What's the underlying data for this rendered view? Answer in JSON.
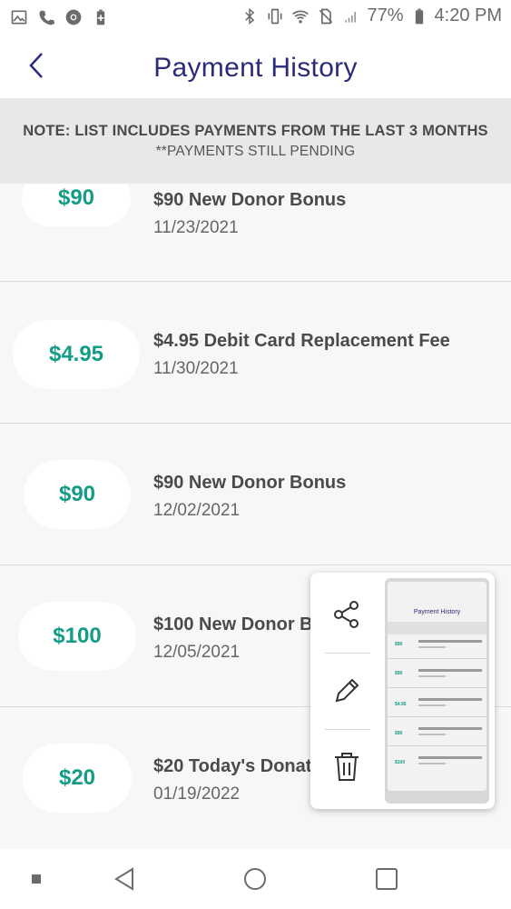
{
  "status_bar": {
    "battery_percent": "77%",
    "time": "4:20 PM",
    "left_icons": [
      "image-icon",
      "phone-icon",
      "chrome-icon",
      "battery-saver-icon"
    ],
    "right_icons": [
      "bluetooth-icon",
      "vibrate-icon",
      "wifi-icon",
      "no-sim-icon",
      "signal-icon",
      "battery-icon"
    ]
  },
  "header": {
    "title": "Payment History",
    "back_icon": "chevron-left-icon"
  },
  "note": {
    "line1": "NOTE: LIST INCLUDES PAYMENTS FROM THE LAST 3 MONTHS",
    "line2": "**PAYMENTS STILL PENDING"
  },
  "payments": [
    {
      "amount": "$90",
      "title": "$90 New Donor Bonus",
      "date": "11/23/2021"
    },
    {
      "amount": "$4.95",
      "title": "$4.95 Debit Card Replacement Fee",
      "date": "11/30/2021"
    },
    {
      "amount": "$90",
      "title": "$90 New Donor Bonus",
      "date": "12/02/2021"
    },
    {
      "amount": "$100",
      "title": "$100 New Donor B",
      "date": "12/05/2021"
    },
    {
      "amount": "$20",
      "title": "$20 Today's Donat",
      "date": "01/19/2022"
    }
  ],
  "screenshot_popup": {
    "actions": [
      "share-icon",
      "edit-icon",
      "delete-icon"
    ],
    "thumbnail_title": "Payment History",
    "thumbnail_amounts": [
      "$90",
      "$90",
      "$4.95",
      "$90",
      "$100"
    ]
  },
  "nav_bar": {
    "buttons": [
      "back-icon",
      "home-icon",
      "recents-icon"
    ]
  },
  "colors": {
    "accent_teal": "#139c86",
    "title_navy": "#2c2a7a"
  }
}
